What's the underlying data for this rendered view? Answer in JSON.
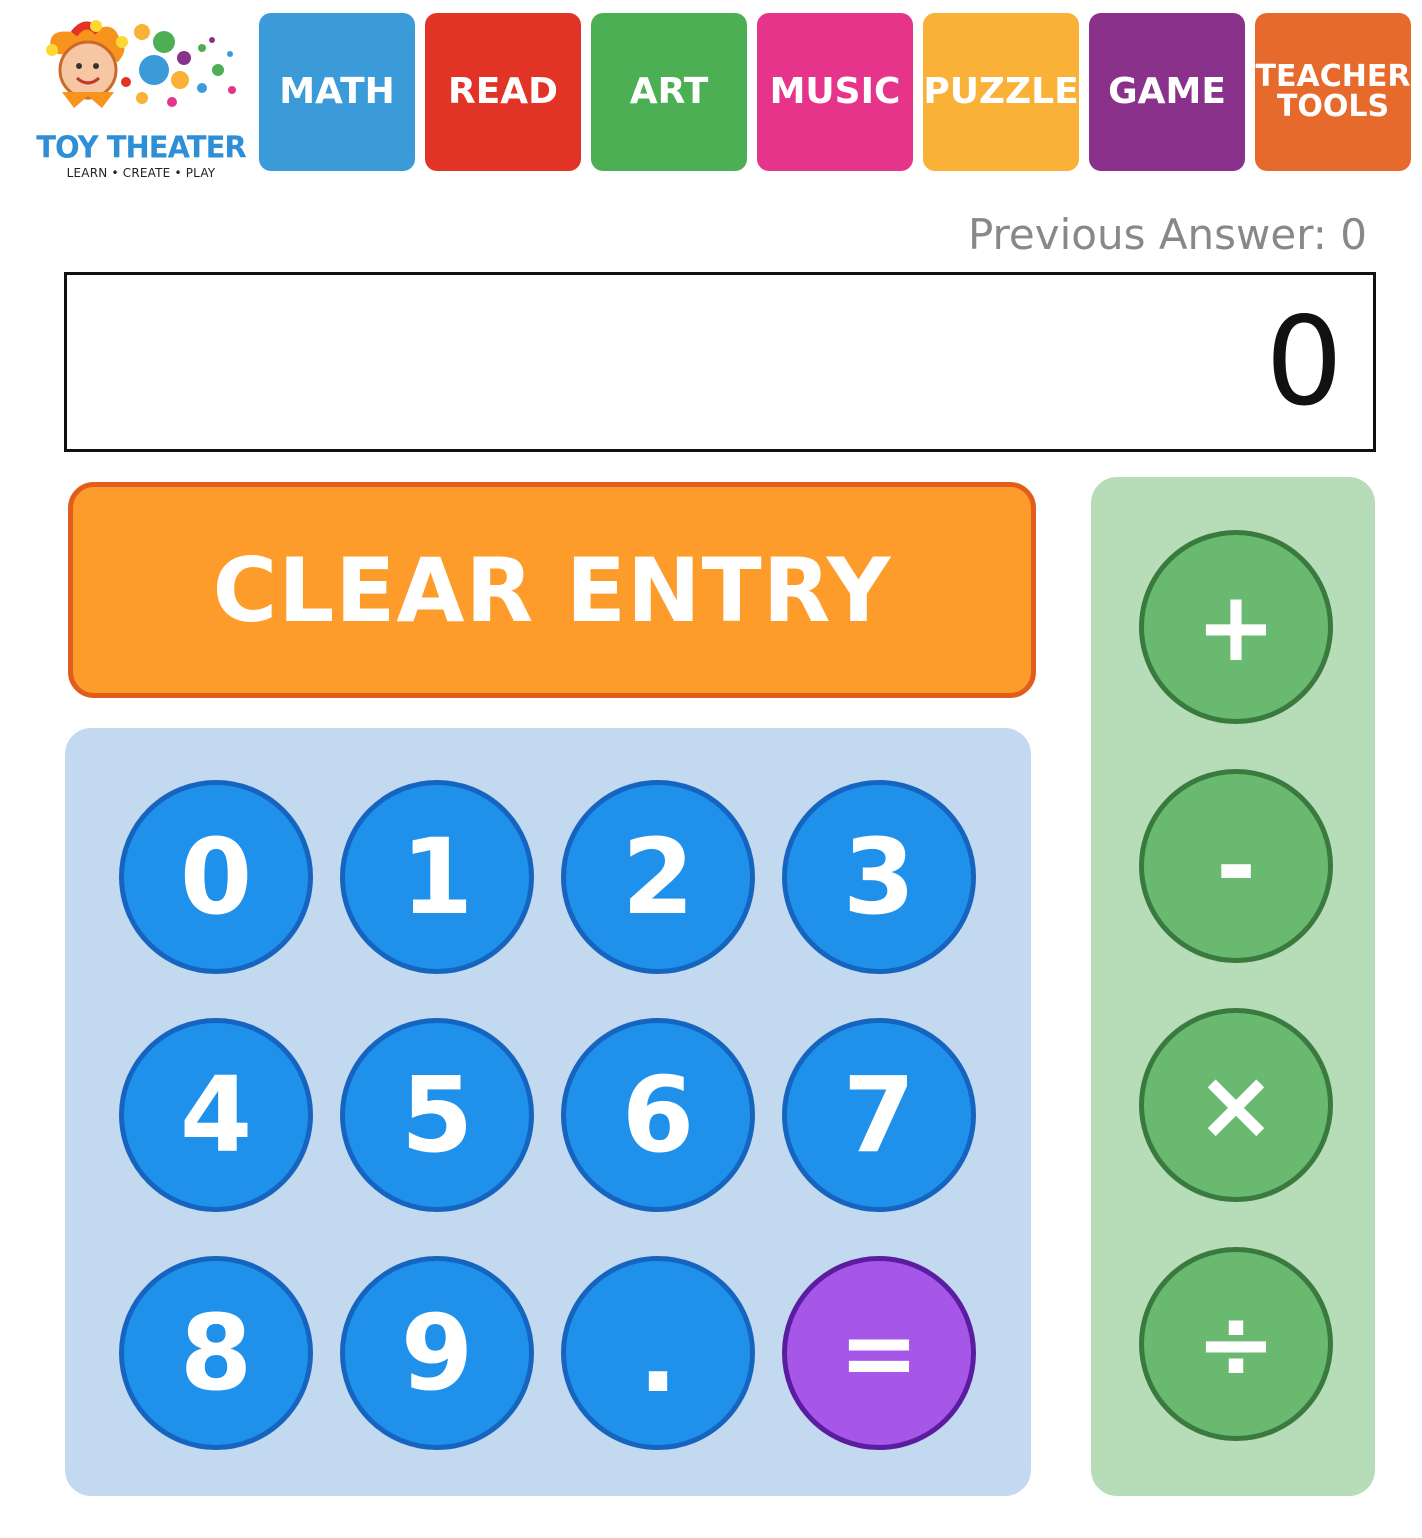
{
  "logo": {
    "title": "TOY THEATER",
    "tagline": "LEARN • CREATE • PLAY"
  },
  "nav": [
    {
      "label": "MATH",
      "color": "#3b9ad8"
    },
    {
      "label": "READ",
      "color": "#e13427"
    },
    {
      "label": "ART",
      "color": "#4caf53"
    },
    {
      "label": "MUSIC",
      "color": "#e6348a"
    },
    {
      "label": "PUZZLE",
      "color": "#f9b137"
    },
    {
      "label": "GAME",
      "color": "#8a318c"
    },
    {
      "label": "TEACHER\nTOOLS",
      "color": "#e76a2d"
    }
  ],
  "calculator": {
    "previous_answer": "Previous Answer: 0",
    "display_value": "0",
    "clear_label": "CLEAR ENTRY",
    "keys": [
      "0",
      "1",
      "2",
      "3",
      "4",
      "5",
      "6",
      "7",
      "8",
      "9",
      ".",
      "="
    ],
    "operators": [
      "+",
      "-",
      "×",
      "÷"
    ]
  },
  "colors": {
    "number_key": "#2091ea",
    "equals_key": "#a757e8",
    "operator_key": "#69b971",
    "clear_button": "#fd9c2b"
  }
}
